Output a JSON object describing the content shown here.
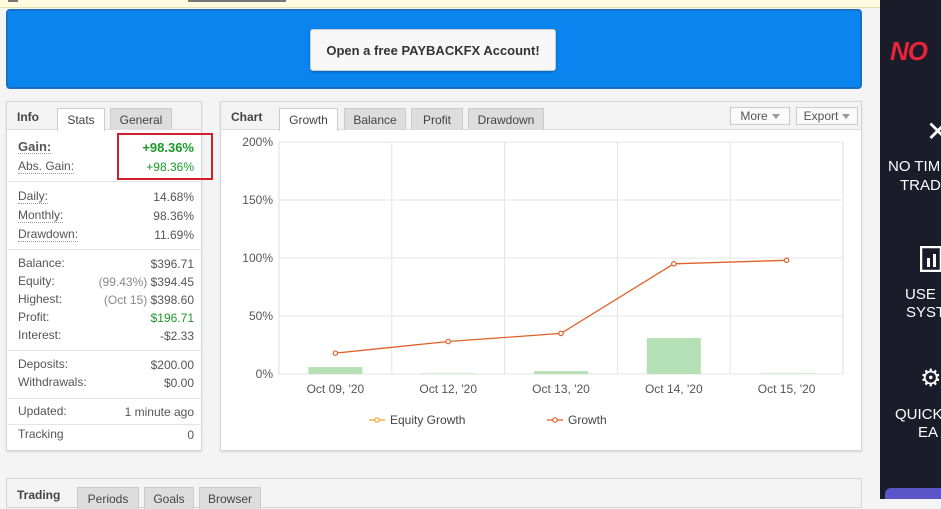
{
  "banner": {
    "cta_label": "Open a free PAYBACKFX Account!"
  },
  "info_panel": {
    "title": "Info",
    "tabs": [
      "Stats",
      "General"
    ],
    "gain": {
      "label": "Gain:",
      "value": "+98.36%"
    },
    "abs_gain": {
      "label": "Abs. Gain:",
      "value": "+98.36%"
    },
    "daily": {
      "label": "Daily:",
      "value": "14.68%"
    },
    "monthly": {
      "label": "Monthly:",
      "value": "98.36%"
    },
    "drawdown": {
      "label": "Drawdown:",
      "value": "11.69%"
    },
    "balance": {
      "label": "Balance:",
      "value": "$396.71"
    },
    "equity": {
      "label": "Equity:",
      "note": "(99.43%)",
      "value": "$394.45"
    },
    "highest": {
      "label": "Highest:",
      "note": "(Oct 15)",
      "value": "$398.60"
    },
    "profit": {
      "label": "Profit:",
      "value": "$196.71"
    },
    "interest": {
      "label": "Interest:",
      "value": "-$2.33"
    },
    "deposits": {
      "label": "Deposits:",
      "value": "$200.00"
    },
    "withdrawals": {
      "label": "Withdrawals:",
      "value": "$0.00"
    },
    "updated": {
      "label": "Updated:",
      "value": "1 minute ago"
    },
    "tracking": {
      "label": "Tracking",
      "value": "0"
    }
  },
  "chart_panel": {
    "title": "Chart",
    "tabs": [
      "Growth",
      "Balance",
      "Profit",
      "Drawdown"
    ],
    "more_label": "More",
    "export_label": "Export"
  },
  "chart_data": {
    "type": "line",
    "categories": [
      "Oct 09, '20",
      "Oct 12, '20",
      "Oct 13, '20",
      "Oct 14, '20",
      "Oct 15, '20"
    ],
    "ylim": [
      0,
      200
    ],
    "yticks": [
      "0%",
      "50%",
      "100%",
      "150%",
      "200%"
    ],
    "series": [
      {
        "name": "Equity Growth",
        "type": "line",
        "color": "#f0a030",
        "values": [
          0,
          0,
          0,
          0,
          0
        ]
      },
      {
        "name": "Growth",
        "type": "line",
        "color": "#e0602a",
        "values": [
          18,
          28,
          35,
          95,
          98
        ]
      },
      {
        "name": "",
        "type": "bar",
        "color": "#b5e0b5",
        "values": [
          6,
          0.5,
          2.5,
          31,
          0.5
        ]
      }
    ],
    "grid": true,
    "legend": "bottom"
  },
  "bottom_panel": {
    "title": "Trading",
    "tabs": [
      "Periods",
      "Goals",
      "Browser"
    ]
  },
  "sidebar_ad": {
    "logo": "NO",
    "line1a": "NO TIM",
    "line1b": "TRAD",
    "line2a": "USE",
    "line2b": "SYST",
    "line3a": "QUICK",
    "line3b": "EA"
  }
}
